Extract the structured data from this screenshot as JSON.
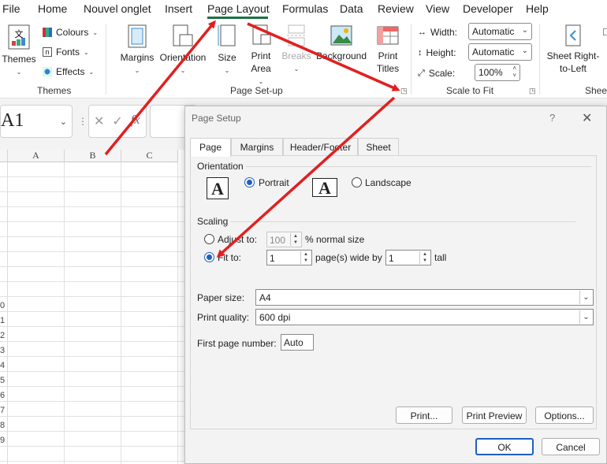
{
  "menu": [
    "File",
    "Home",
    "Nouvel onglet",
    "Insert",
    "Page Layout",
    "Formulas",
    "Data",
    "Review",
    "View",
    "Developer",
    "Help"
  ],
  "ribbon": {
    "themes": {
      "themes_label": "Themes",
      "colours": "Colours",
      "fonts": "Fonts",
      "effects": "Effects",
      "group": "Themes"
    },
    "page_setup": {
      "margins": "Margins",
      "orientation": "Orientation",
      "size": "Size",
      "print_area": [
        "Print",
        "Area"
      ],
      "breaks": "Breaks",
      "background": "Background",
      "print_titles": [
        "Print",
        "Titles"
      ],
      "group": "Page Set-up"
    },
    "scale": {
      "width_label": "Width:",
      "width_value": "Automatic",
      "height_label": "Height:",
      "height_value": "Automatic",
      "scale_label": "Scale:",
      "scale_value": "100%",
      "group": "Scale to Fit"
    },
    "sheet": {
      "rtl": [
        "Sheet Right-",
        "to-Left"
      ],
      "group": "Sheet"
    }
  },
  "formula_bar": {
    "name_box": "A1",
    "fx": "fx"
  },
  "grid": {
    "columns": [
      "A",
      "B",
      "C"
    ],
    "row_numbers": [
      "0",
      "1",
      "2",
      "3",
      "4",
      "5",
      "6",
      "7",
      "8",
      "9"
    ]
  },
  "dialog": {
    "title": "Page Setup",
    "help": "?",
    "tabs": [
      "Page",
      "Margins",
      "Header/Footer",
      "Sheet"
    ],
    "orientation": {
      "label": "Orientation",
      "portrait": "Portrait",
      "landscape": "Landscape",
      "glyph": "A",
      "selected": "portrait"
    },
    "scaling": {
      "label": "Scaling",
      "adjust_to": "Adjust to:",
      "adjust_value": "100",
      "normal_size": "% normal size",
      "fit_to": "Fit to:",
      "wide_value": "1",
      "wide_label": "page(s) wide by",
      "tall_value": "1",
      "tall_label": "tall",
      "selected": "fit_to"
    },
    "paper_size": {
      "label": "Paper size:",
      "value": "A4"
    },
    "print_quality": {
      "label": "Print quality:",
      "value": "600 dpi"
    },
    "first_page": {
      "label": "First page number:",
      "value": "Auto"
    },
    "buttons": {
      "print": "Print...",
      "preview": "Print Preview",
      "options": "Options...",
      "ok": "OK",
      "cancel": "Cancel"
    }
  },
  "colors": {
    "accent": "#1e7145",
    "annotation": "#e02020",
    "radio": "#1f5fbf"
  }
}
